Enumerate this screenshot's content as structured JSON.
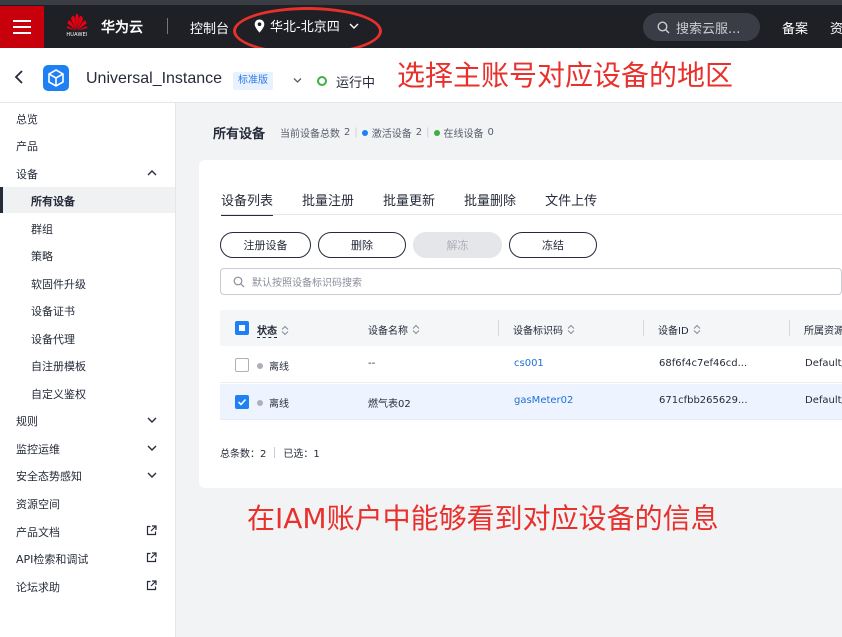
{
  "topbar": {
    "logo_wordmark": "HUAWEI",
    "brand": "华为云",
    "console": "控制台",
    "region": "华北-北京四",
    "search_placeholder": "搜索云服...",
    "beian": "备案",
    "more": "资"
  },
  "annotations": {
    "top": "选择主账号对应设备的地区",
    "bottom": "在IAM账户中能够看到对应设备的信息"
  },
  "instance": {
    "name": "Universal_Instance",
    "edition": "标准版",
    "status": "运行中"
  },
  "sidebar": {
    "items": [
      {
        "label": "总览"
      },
      {
        "label": "产品"
      },
      {
        "label": "设备"
      },
      {
        "label": "所有设备"
      },
      {
        "label": "群组"
      },
      {
        "label": "策略"
      },
      {
        "label": "软固件升级"
      },
      {
        "label": "设备证书"
      },
      {
        "label": "设备代理"
      },
      {
        "label": "自注册模板"
      },
      {
        "label": "自定义鉴权"
      },
      {
        "label": "规则"
      },
      {
        "label": "监控运维"
      },
      {
        "label": "安全态势感知"
      },
      {
        "label": "资源空间"
      },
      {
        "label": "产品文档"
      },
      {
        "label": "API检索和调试"
      },
      {
        "label": "论坛求助"
      }
    ]
  },
  "main": {
    "title": "所有设备",
    "stats": {
      "total_label": "当前设备总数",
      "total": "2",
      "active_label": "激活设备",
      "active": "2",
      "online_label": "在线设备",
      "online": "0"
    },
    "tabs": [
      {
        "label": "设备列表"
      },
      {
        "label": "批量注册"
      },
      {
        "label": "批量更新"
      },
      {
        "label": "批量删除"
      },
      {
        "label": "文件上传"
      }
    ],
    "buttons": {
      "register": "注册设备",
      "delete": "删除",
      "unfreeze": "解冻",
      "freeze": "冻结"
    },
    "search_placeholder": "默认按照设备标识码搜索",
    "columns": {
      "status": "状态",
      "name": "设备名称",
      "identifier": "设备标识码",
      "device_id": "设备ID",
      "space": "所属资源"
    },
    "rows": [
      {
        "status": "离线",
        "name": "--",
        "identifier": "cs001",
        "device_id": "68f6f4c7ef46cd...",
        "space": "Default/"
      },
      {
        "status": "离线",
        "name": "燃气表02",
        "identifier": "gasMeter02",
        "device_id": "671cfbb265629...",
        "space": "Default/"
      }
    ],
    "footer": {
      "total_label": "总条数：",
      "total": "2",
      "selected_label": "已选：",
      "selected": "1"
    }
  },
  "colors": {
    "brand_red": "#c7000b",
    "annotation_red": "#e8302c",
    "link_blue": "#1f6fd8",
    "running_green": "#3fb040"
  }
}
